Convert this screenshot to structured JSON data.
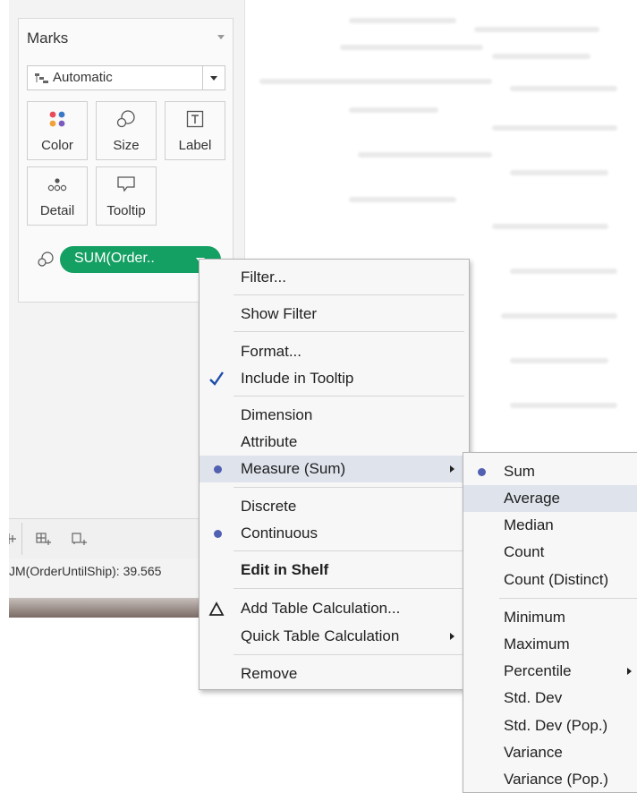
{
  "marks": {
    "title": "Marks",
    "mark_type": "Automatic",
    "buttons": [
      {
        "label": "Color",
        "icon": "color-dots-icon"
      },
      {
        "label": "Size",
        "icon": "size-icon"
      },
      {
        "label": "Label",
        "icon": "label-icon"
      },
      {
        "label": "Detail",
        "icon": "detail-icon"
      },
      {
        "label": "Tooltip",
        "icon": "tooltip-icon"
      }
    ],
    "pill": {
      "label": "SUM(Order..",
      "color": "#15a063",
      "icon": "size-icon"
    }
  },
  "status": {
    "text": "JM(OrderUntilShip): 39.565"
  },
  "context_menu": {
    "items": [
      {
        "label": "Filter..."
      },
      {
        "label": "Show Filter"
      },
      {
        "label": "Format..."
      },
      {
        "label": "Include in Tooltip",
        "mark": "checkmark"
      },
      {
        "label": "Dimension"
      },
      {
        "label": "Attribute"
      },
      {
        "label": "Measure (Sum)",
        "mark": "radio-dot",
        "submenu": true
      },
      {
        "label": "Discrete"
      },
      {
        "label": "Continuous",
        "mark": "radio-dot"
      },
      {
        "label": "Edit in Shelf",
        "bold": true
      },
      {
        "label": "Add Table Calculation...",
        "mark": "delta"
      },
      {
        "label": "Quick Table Calculation",
        "submenu": true
      },
      {
        "label": "Remove"
      }
    ]
  },
  "measure_submenu": {
    "items": [
      {
        "label": "Sum",
        "selected": true
      },
      {
        "label": "Average",
        "hover": true
      },
      {
        "label": "Median"
      },
      {
        "label": "Count"
      },
      {
        "label": "Count (Distinct)"
      },
      {
        "label": "Minimum"
      },
      {
        "label": "Maximum"
      },
      {
        "label": "Percentile",
        "submenu": true
      },
      {
        "label": "Std. Dev"
      },
      {
        "label": "Std. Dev (Pop.)"
      },
      {
        "label": "Variance"
      },
      {
        "label": "Variance (Pop.)"
      }
    ]
  },
  "colors": {
    "accent_green": "#15a063",
    "radio_dot": "#5160b0",
    "checkmark": "#1f4ea8",
    "highlight": "#dfe3ec"
  }
}
